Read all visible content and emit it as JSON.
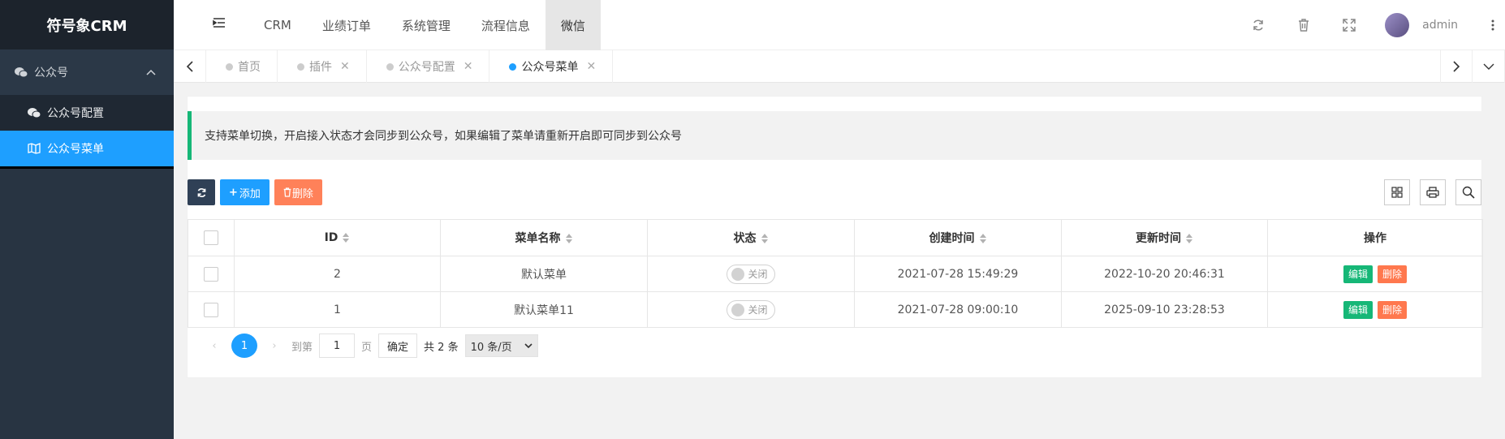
{
  "app": {
    "logo": "符号象CRM"
  },
  "sidebar": {
    "group": {
      "label": "公众号",
      "icon": "wechat-icon"
    },
    "items": [
      {
        "label": "公众号配置",
        "icon": "wechat-icon",
        "active": false
      },
      {
        "label": "公众号菜单",
        "icon": "map-icon",
        "active": true
      }
    ]
  },
  "topnav": {
    "items": [
      {
        "label": "CRM"
      },
      {
        "label": "业绩订单"
      },
      {
        "label": "系统管理"
      },
      {
        "label": "流程信息"
      },
      {
        "label": "微信",
        "active": true
      }
    ],
    "user": "admin"
  },
  "tabs": [
    {
      "label": "首页",
      "closable": false
    },
    {
      "label": "插件",
      "closable": true
    },
    {
      "label": "公众号配置",
      "closable": true
    },
    {
      "label": "公众号菜单",
      "closable": true,
      "active": true
    }
  ],
  "notice": "支持菜单切换，开启接入状态才会同步到公众号，如果编辑了菜单请重新开启即可同步到公众号",
  "toolbar": {
    "add": "添加",
    "delete": "删除"
  },
  "table": {
    "columns": [
      "ID",
      "菜单名称",
      "状态",
      "创建时间",
      "更新时间",
      "操作"
    ],
    "rows": [
      {
        "id": "2",
        "name": "默认菜单",
        "status": "关闭",
        "created": "2021-07-28 15:49:29",
        "updated": "2022-10-20 20:46:31",
        "edit": "编辑",
        "del": "删除"
      },
      {
        "id": "1",
        "name": "默认菜单11",
        "status": "关闭",
        "created": "2021-07-28 09:00:10",
        "updated": "2025-09-10 23:28:53",
        "edit": "编辑",
        "del": "删除"
      }
    ]
  },
  "pager": {
    "current": "1",
    "goto_label": "到第",
    "goto_value": "1",
    "page_suffix": "页",
    "confirm": "确定",
    "total": "共 2 条",
    "per_page": "10 条/页"
  },
  "colors": {
    "sidebar": "#283442",
    "accent": "#1e9fff",
    "green": "#16b777",
    "red": "#ff5722"
  }
}
